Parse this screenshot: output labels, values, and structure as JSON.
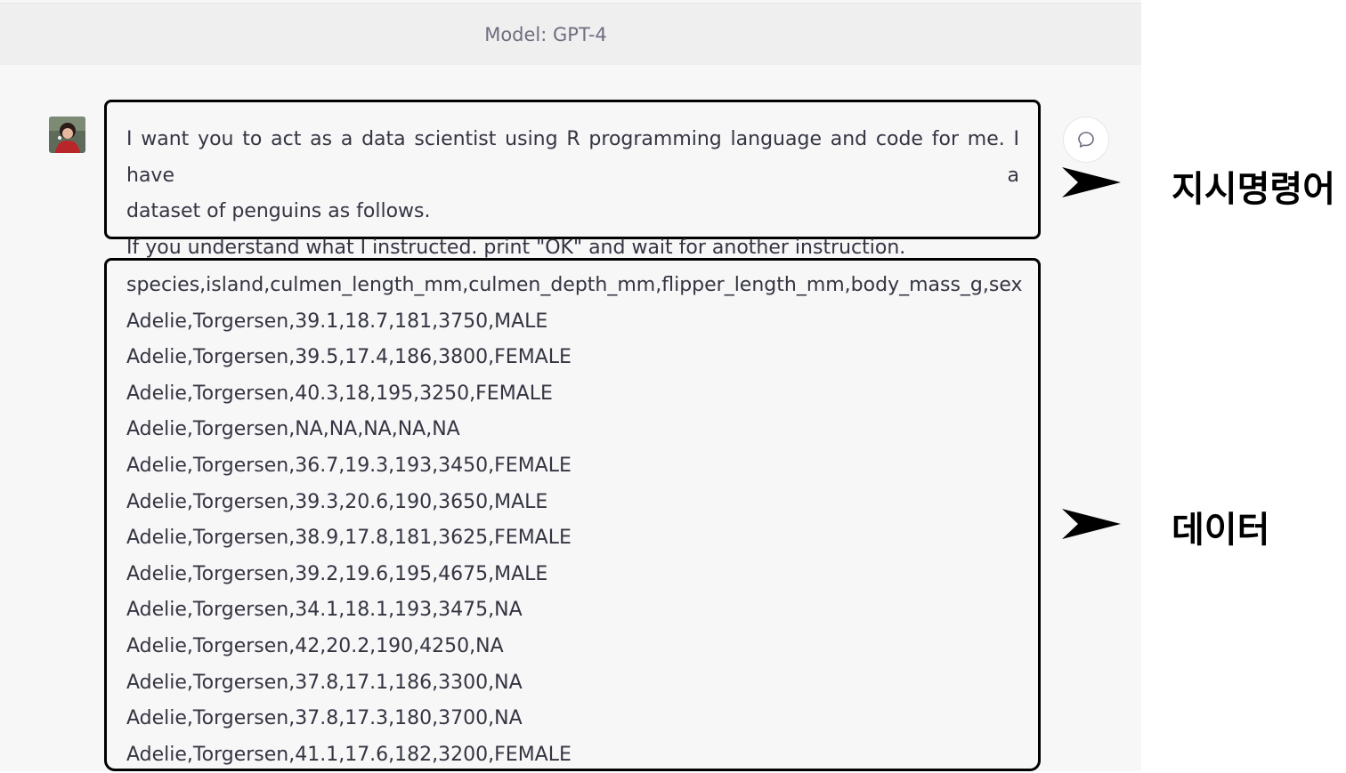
{
  "header": {
    "title": "Model: GPT-4"
  },
  "user_message": {
    "avatar": "user-avatar",
    "lines": [
      "I want you to act as a data scientist using R programming language and code for me. I have a",
      "dataset of penguins as follows.",
      "If you understand what I instructed. print \"OK\" and wait for another instruction."
    ]
  },
  "data_message": {
    "lines": [
      "species,island,culmen_length_mm,culmen_depth_mm,flipper_length_mm,body_mass_g,sex",
      "Adelie,Torgersen,39.1,18.7,181,3750,MALE",
      "Adelie,Torgersen,39.5,17.4,186,3800,FEMALE",
      "Adelie,Torgersen,40.3,18,195,3250,FEMALE",
      "Adelie,Torgersen,NA,NA,NA,NA,NA",
      "Adelie,Torgersen,36.7,19.3,193,3450,FEMALE",
      "Adelie,Torgersen,39.3,20.6,190,3650,MALE",
      "Adelie,Torgersen,38.9,17.8,181,3625,FEMALE",
      "Adelie,Torgersen,39.2,19.6,195,4675,MALE",
      "Adelie,Torgersen,34.1,18.1,193,3475,NA",
      "Adelie,Torgersen,42,20.2,190,4250,NA",
      "Adelie,Torgersen,37.8,17.1,186,3300,NA",
      "Adelie,Torgersen,37.8,17.3,180,3700,NA",
      "Adelie,Torgersen,41.1,17.6,182,3200,FEMALE"
    ]
  },
  "annotations": {
    "instruction_label": "지시명령어",
    "data_label": "데이터"
  },
  "icons": {
    "comment": "comment-icon",
    "arrow": "arrow-right-icon"
  }
}
